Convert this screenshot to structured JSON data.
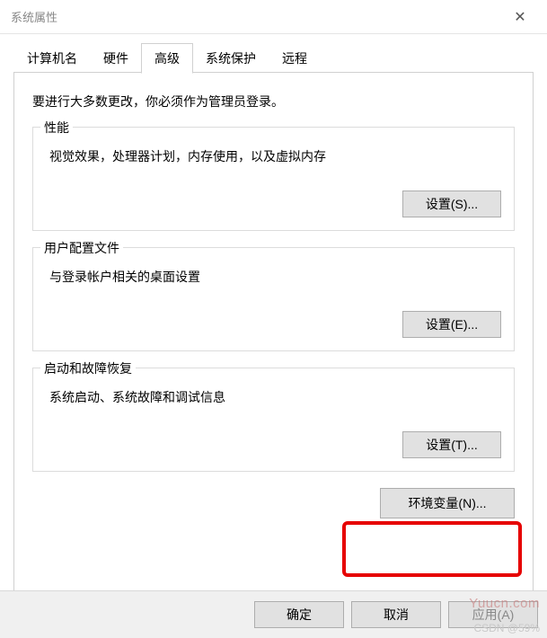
{
  "window": {
    "title": "系统属性"
  },
  "tabs": {
    "computer_name": "计算机名",
    "hardware": "硬件",
    "advanced": "高级",
    "system_protection": "系统保护",
    "remote": "远程"
  },
  "content": {
    "intro": "要进行大多数更改，你必须作为管理员登录。",
    "performance": {
      "title": "性能",
      "desc": "视觉效果，处理器计划，内存使用，以及虚拟内存",
      "button": "设置(S)..."
    },
    "user_profiles": {
      "title": "用户配置文件",
      "desc": "与登录帐户相关的桌面设置",
      "button": "设置(E)..."
    },
    "startup": {
      "title": "启动和故障恢复",
      "desc": "系统启动、系统故障和调试信息",
      "button": "设置(T)..."
    },
    "env_button": "环境变量(N)..."
  },
  "buttons": {
    "ok": "确定",
    "cancel": "取消",
    "apply": "应用(A)"
  },
  "watermark": "Yuucn.com",
  "watermark2": "CSDN @59%"
}
